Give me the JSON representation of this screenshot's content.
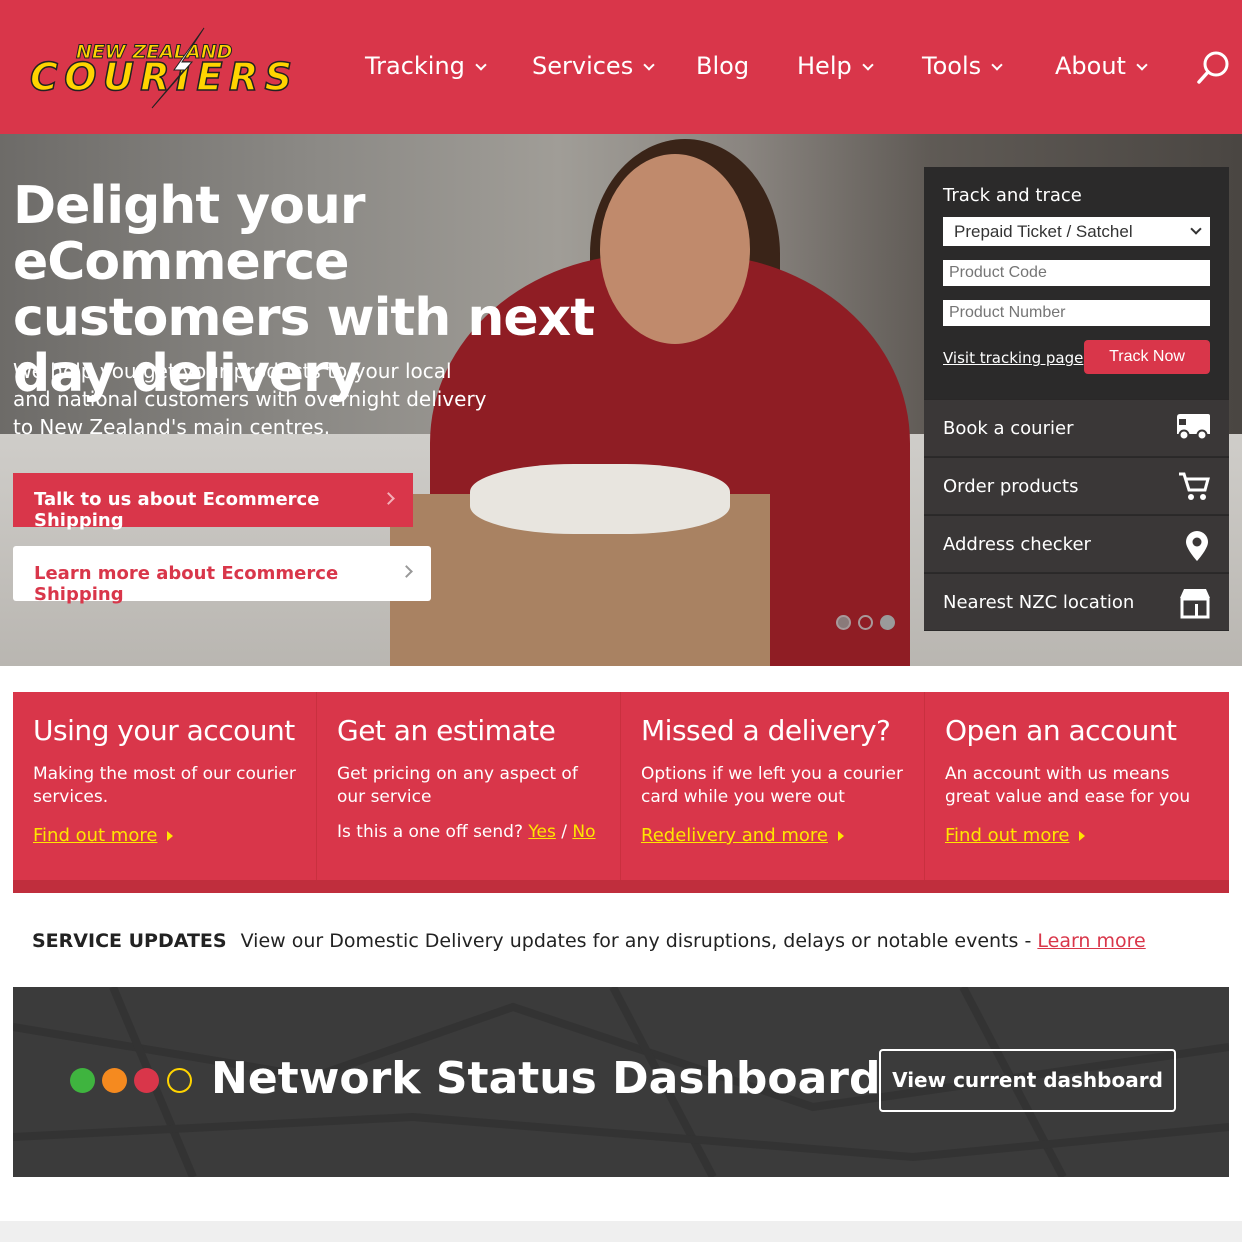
{
  "header": {
    "logo_text_top": "NEW ZEALAND",
    "logo_text_main": "COURIERS",
    "nav": [
      {
        "label": "Tracking",
        "dropdown": true
      },
      {
        "label": "Services",
        "dropdown": true
      },
      {
        "label": "Blog",
        "dropdown": false
      },
      {
        "label": "Help",
        "dropdown": true
      },
      {
        "label": "Tools",
        "dropdown": true
      },
      {
        "label": "About",
        "dropdown": true
      }
    ],
    "search_icon": "search-icon"
  },
  "hero": {
    "title": "Delight your eCommerce customers with next day delivery",
    "subtitle": "We help you get your products to your local and national customers with overnight delivery to New Zealand's main centres.",
    "primary_button": "Talk to us about Ecommerce Shipping",
    "secondary_button": "Learn more about Ecommerce Shipping",
    "carousel": {
      "slides": 3,
      "active": 1
    }
  },
  "track_panel": {
    "title": "Track and trace",
    "select_value": "Prepaid Ticket / Satchel",
    "code_placeholder": "Product Code",
    "number_placeholder": "Product Number",
    "visit_link": "Visit tracking page",
    "track_button": "Track Now",
    "links": [
      {
        "label": "Book a courier",
        "icon": "truck-icon"
      },
      {
        "label": "Order products",
        "icon": "cart-icon"
      },
      {
        "label": "Address checker",
        "icon": "map-pin-icon"
      },
      {
        "label": "Nearest NZC location",
        "icon": "store-icon"
      }
    ]
  },
  "cards": [
    {
      "title": "Using your account",
      "text": "Making the most of our courier services.",
      "link": "Find out more"
    },
    {
      "title": "Get an estimate",
      "text": "Get pricing on any aspect of our service",
      "question": "Is this a one off send?",
      "yes": "Yes",
      "sep": "/",
      "no": "No"
    },
    {
      "title": "Missed a delivery?",
      "text": "Options if we left you a courier card while you were out",
      "link": "Redelivery and more"
    },
    {
      "title": "Open an account",
      "text": "An account with us means great value and ease for you",
      "link": "Find out more"
    }
  ],
  "service_updates": {
    "label": "SERVICE UPDATES",
    "text": "View our Domestic Delivery updates for any disruptions, delays or notable events -",
    "link": "Learn more"
  },
  "dashboard": {
    "title": "Network Status Dashboard",
    "button": "View current dashboard",
    "lights": [
      "#3fb43f",
      "#f58a1f",
      "#d9364a",
      "#ffd400"
    ]
  },
  "colors": {
    "brand_red": "#d9364a",
    "logo_yellow": "#ffd400",
    "panel_dark": "#2b2a2a",
    "link_yellow": "#ffe600"
  }
}
